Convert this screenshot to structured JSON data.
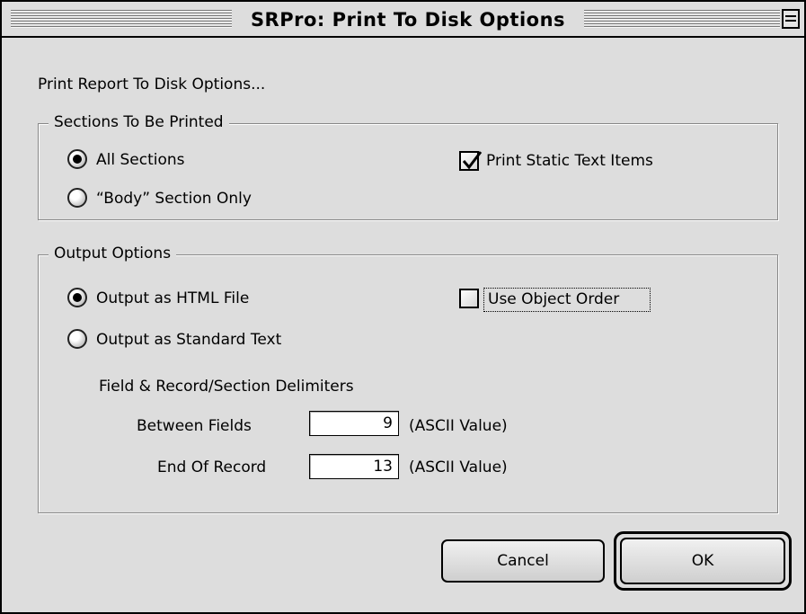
{
  "window": {
    "title": "SRPro: Print To Disk Options"
  },
  "intro": "Print Report To Disk Options...",
  "sections_group": {
    "label": "Sections To Be Printed",
    "all_sections": {
      "label": "All Sections",
      "selected": true
    },
    "body_only": {
      "label": "“Body” Section Only",
      "selected": false
    },
    "static_text": {
      "label": "Print Static Text Items",
      "checked": true
    }
  },
  "output_group": {
    "label": "Output Options",
    "html_file": {
      "label": "Output as HTML File",
      "selected": true
    },
    "standard_text": {
      "label": "Output as Standard Text",
      "selected": false
    },
    "object_order": {
      "label": "Use Object Order",
      "checked": false
    },
    "delimiters_heading": "Field & Record/Section Delimiters",
    "between_fields": {
      "label": "Between Fields",
      "value": "9",
      "unit": "(ASCII Value)"
    },
    "end_of_record": {
      "label": "End Of Record",
      "value": "13",
      "unit": "(ASCII Value)"
    }
  },
  "buttons": {
    "cancel": "Cancel",
    "ok": "OK"
  },
  "icons": {
    "collapse": "collapse-box-icon",
    "radio": "radio-icon",
    "check": "checkmark-icon"
  }
}
